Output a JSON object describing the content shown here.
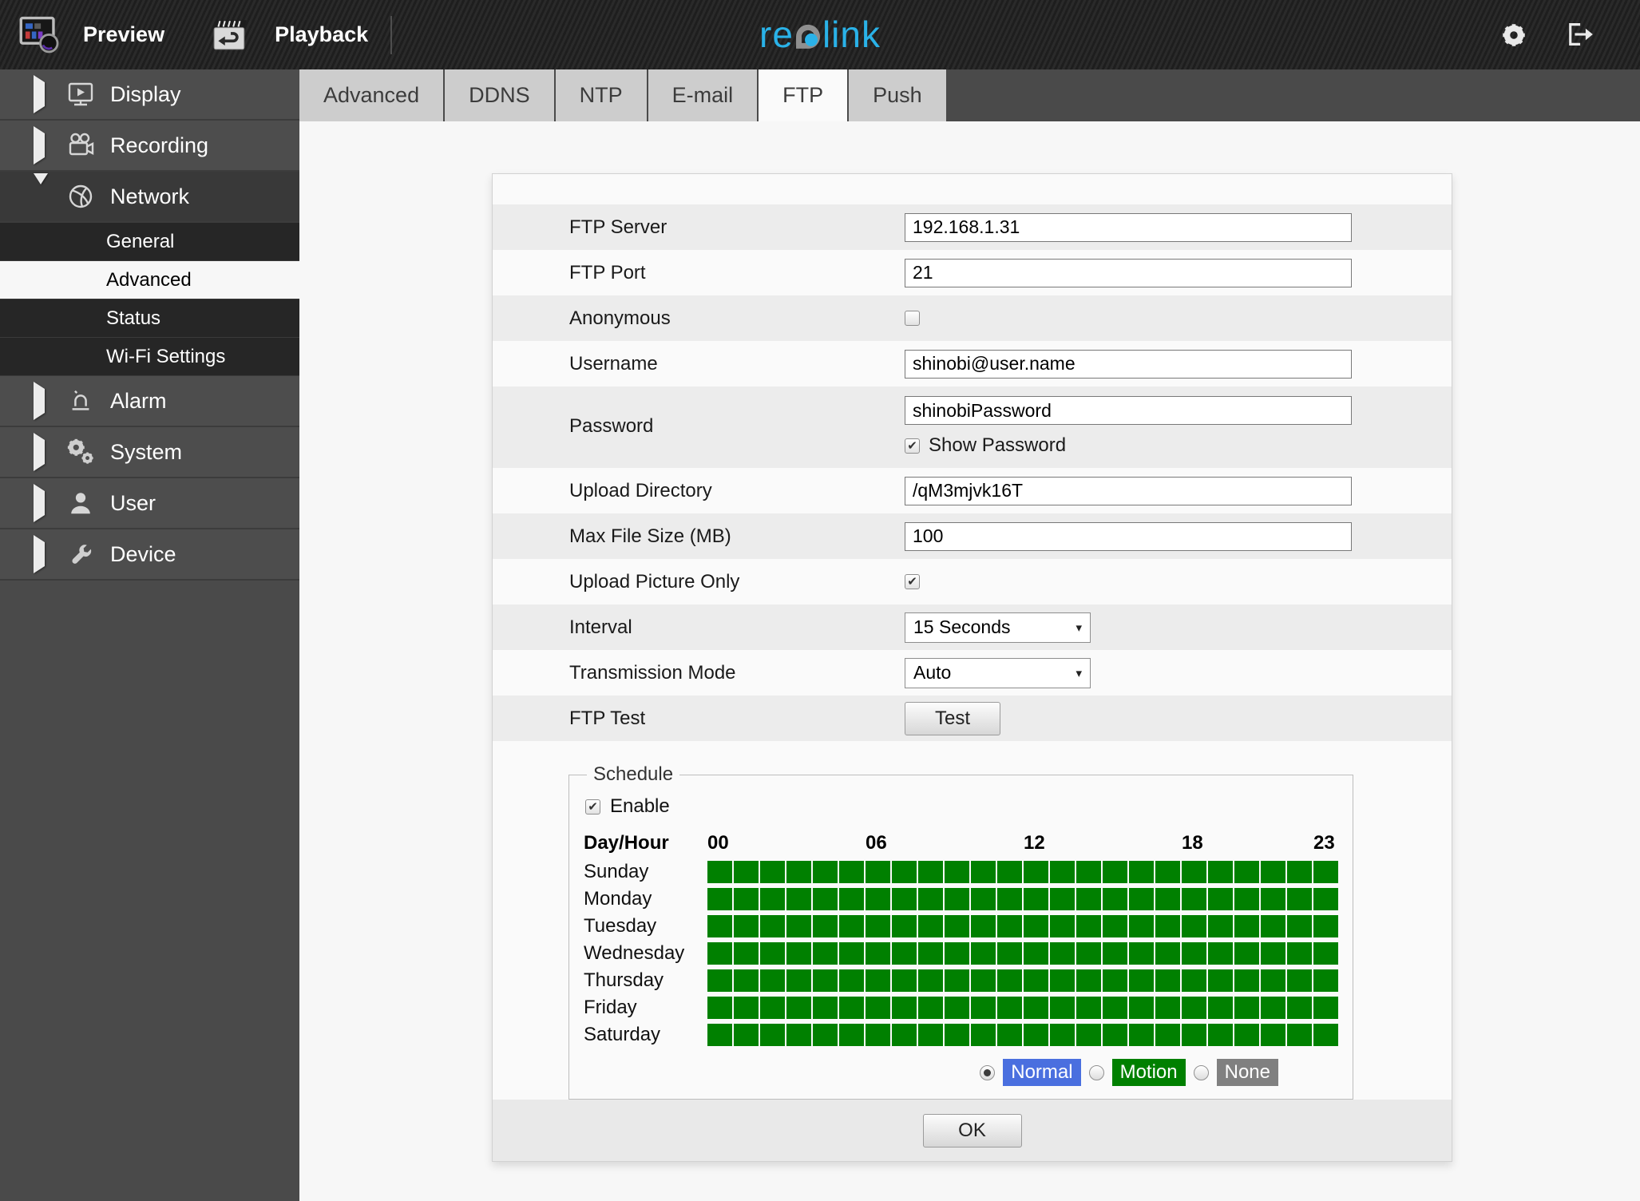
{
  "header": {
    "preview_label": "Preview",
    "playback_label": "Playback",
    "brand_re": "re",
    "brand_link": "link",
    "brand_blue": "#2ab2e8"
  },
  "sidebar": {
    "items": [
      {
        "id": "display",
        "label": "Display",
        "icon": "display-icon",
        "expanded": false
      },
      {
        "id": "recording",
        "label": "Recording",
        "icon": "recording-icon",
        "expanded": false
      },
      {
        "id": "network",
        "label": "Network",
        "icon": "network-icon",
        "expanded": true,
        "children": [
          {
            "id": "general",
            "label": "General",
            "selected": false
          },
          {
            "id": "advanced",
            "label": "Advanced",
            "selected": true
          },
          {
            "id": "status",
            "label": "Status",
            "selected": false
          },
          {
            "id": "wifi-settings",
            "label": "Wi-Fi Settings",
            "selected": false
          }
        ]
      },
      {
        "id": "alarm",
        "label": "Alarm",
        "icon": "alarm-icon",
        "expanded": false
      },
      {
        "id": "system",
        "label": "System",
        "icon": "system-icon",
        "expanded": false
      },
      {
        "id": "user",
        "label": "User",
        "icon": "user-icon",
        "expanded": false
      },
      {
        "id": "device",
        "label": "Device",
        "icon": "device-icon",
        "expanded": false
      }
    ]
  },
  "tabs": {
    "items": [
      "Advanced",
      "DDNS",
      "NTP",
      "E-mail",
      "FTP",
      "Push"
    ],
    "active": "FTP"
  },
  "form": {
    "rows": [
      {
        "id": "ftp-server",
        "label": "FTP Server",
        "type": "text",
        "value": "192.168.1.31"
      },
      {
        "id": "ftp-port",
        "label": "FTP Port",
        "type": "text",
        "value": "21"
      },
      {
        "id": "anonymous",
        "label": "Anonymous",
        "type": "checkbox",
        "checked": false
      },
      {
        "id": "username",
        "label": "Username",
        "type": "text",
        "value": "shinobi@user.name"
      },
      {
        "id": "password",
        "label": "Password",
        "type": "text",
        "value": "shinobiPassword",
        "sub_checkbox": {
          "label": "Show Password",
          "checked": true
        }
      },
      {
        "id": "upload-directory",
        "label": "Upload Directory",
        "type": "text",
        "value": "/qM3mjvk16T"
      },
      {
        "id": "max-file-size",
        "label": "Max File Size (MB)",
        "type": "text",
        "value": "100"
      },
      {
        "id": "upload-picture-only",
        "label": "Upload Picture Only",
        "type": "checkbox",
        "checked": true
      },
      {
        "id": "interval",
        "label": "Interval",
        "type": "select",
        "value": "15 Seconds"
      },
      {
        "id": "transmission-mode",
        "label": "Transmission Mode",
        "type": "select",
        "value": "Auto"
      },
      {
        "id": "ftp-test",
        "label": "FTP Test",
        "type": "button",
        "value": "Test",
        "control_name": "test-button"
      }
    ],
    "ok_label": "OK"
  },
  "schedule": {
    "title": "Schedule",
    "enable_label": "Enable",
    "enable_checked": true,
    "corner_label": "Day/Hour",
    "hours": 24,
    "hour_labels": [
      {
        "text": "00",
        "col": 0
      },
      {
        "text": "06",
        "col": 6
      },
      {
        "text": "12",
        "col": 12
      },
      {
        "text": "18",
        "col": 18
      },
      {
        "text": "23",
        "col": 23
      }
    ],
    "days": [
      "Sunday",
      "Monday",
      "Tuesday",
      "Wednesday",
      "Thursday",
      "Friday",
      "Saturday"
    ],
    "cells_on": "all",
    "cell_on_color": "#008000",
    "modes": [
      {
        "label": "Normal",
        "color": "#4a6fdf",
        "selected": true
      },
      {
        "label": "Motion",
        "color": "#008000",
        "selected": false
      },
      {
        "label": "None",
        "color": "#808080",
        "selected": false
      }
    ]
  }
}
